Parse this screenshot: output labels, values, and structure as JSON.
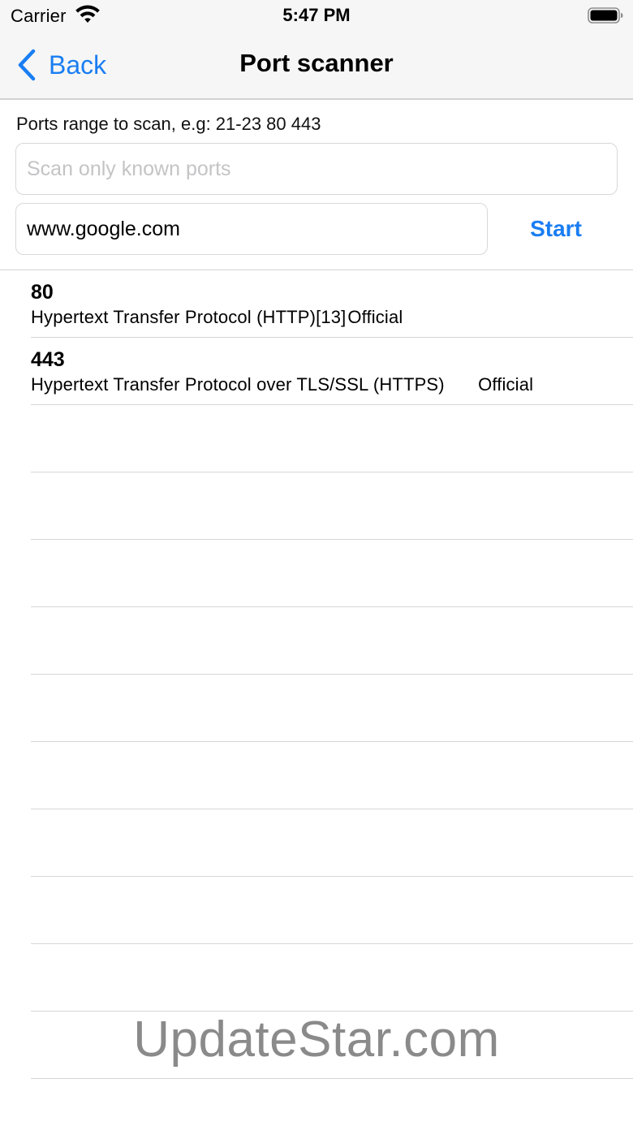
{
  "status_bar": {
    "carrier": "Carrier",
    "time": "5:47 PM",
    "icons": [
      "wifi-icon",
      "battery-icon"
    ]
  },
  "nav_bar": {
    "back_label": "Back",
    "title": "Port scanner"
  },
  "form": {
    "ports_label": "Ports range to scan, e.g: 21-23 80 443",
    "ports_placeholder": "Scan only known ports",
    "ports_value": "",
    "host_value": "www.google.com",
    "start_label": "Start"
  },
  "results": [
    {
      "port": "80",
      "description": "Hypertext Transfer Protocol (HTTP)[13] Official"
    },
    {
      "port": "443",
      "description": "Hypertext Transfer Protocol over TLS/SSL (HTTPS)\t\tOfficial"
    },
    {
      "port": "",
      "description": ""
    },
    {
      "port": "",
      "description": ""
    },
    {
      "port": "",
      "description": ""
    },
    {
      "port": "",
      "description": ""
    },
    {
      "port": "",
      "description": ""
    },
    {
      "port": "",
      "description": ""
    },
    {
      "port": "",
      "description": ""
    },
    {
      "port": "",
      "description": ""
    },
    {
      "port": "",
      "description": ""
    },
    {
      "port": "",
      "description": ""
    }
  ],
  "watermark": "UpdateStar.com",
  "colors": {
    "accent": "#1a7ef2",
    "bar_background": "#f6f6f6",
    "separator": "#d6d6d6",
    "placeholder": "#c4c4c6",
    "watermark": "#8a8a8a"
  }
}
